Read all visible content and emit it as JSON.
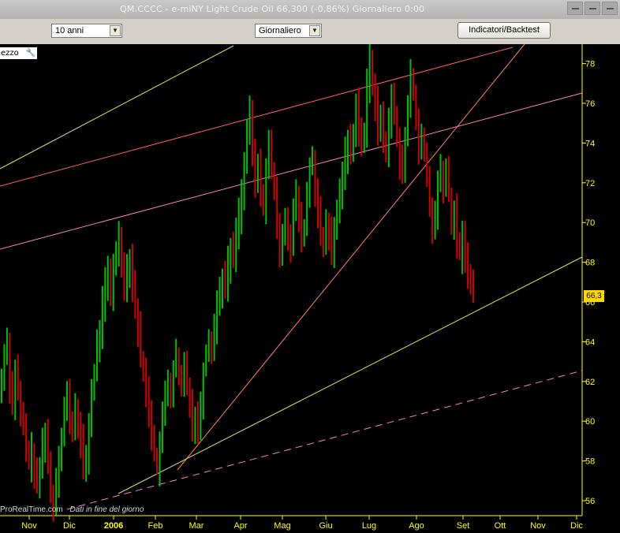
{
  "window": {
    "title": "QM.CCCC - e-miNY Light Crude Oil    66,300 (-0,86%)    Giornaliero  0:00"
  },
  "toolbar": {
    "period": "10 anni",
    "interval": "Giornaliero",
    "indicators_label": "Indicatori/Backtest"
  },
  "chart_panel": {
    "label": "ezzo",
    "price_badge": "66,3",
    "footer_source": "ProRealTime.com",
    "footer_note": "Dati in fine del giorno"
  },
  "colors": {
    "background": "#000000",
    "up": "#00c000",
    "down": "#d00000",
    "axis_text": "#ffff00",
    "badge": "#ffd700"
  },
  "chart_data": {
    "type": "bar",
    "description_free": true,
    "y_axis": {
      "min": 55.5,
      "max": 78.8,
      "ticks": [
        56,
        58,
        60,
        62,
        64,
        66,
        68,
        70,
        72,
        74,
        76,
        78
      ]
    },
    "x_ticks": [
      "Nov",
      "Dic",
      "2006",
      "Feb",
      "Mar",
      "Apr",
      "Mag",
      "Giu",
      "Lug",
      "Ago",
      "Set",
      "Ott",
      "Nov",
      "Dic"
    ],
    "last_price": 66.3,
    "closes": [
      62.0,
      63.5,
      64.1,
      61.8,
      60.9,
      62.6,
      61.4,
      60.2,
      59.7,
      58.6,
      57.9,
      58.5,
      57.2,
      56.8,
      57.6,
      58.9,
      59.5,
      57.8,
      56.4,
      55.8,
      57.1,
      58.4,
      59.2,
      60.6,
      61.3,
      60.1,
      59.4,
      60.8,
      59.7,
      58.9,
      57.6,
      58.2,
      59.8,
      61.5,
      62.4,
      63.8,
      64.6,
      65.9,
      66.8,
      67.5,
      66.1,
      67.9,
      68.6,
      69.3,
      68.2,
      66.6,
      67.7,
      68.3,
      66.9,
      65.8,
      64.6,
      63.2,
      62.4,
      61.5,
      60.6,
      59.4,
      58.3,
      57.6,
      58.8,
      60.1,
      61.4,
      62.1,
      61.2,
      62.6,
      63.3,
      62.1,
      61.6,
      62.9,
      61.9,
      61.0,
      59.8,
      60.2,
      59.6,
      61.0,
      62.6,
      63.5,
      64.2,
      63.6,
      64.8,
      65.9,
      66.6,
      67.3,
      66.8,
      67.9,
      68.6,
      68.3,
      69.6,
      70.4,
      71.5,
      72.8,
      74.6,
      75.4,
      73.4,
      72.1,
      72.8,
      71.6,
      70.9,
      72.6,
      73.9,
      72.6,
      71.8,
      69.5,
      68.4,
      69.6,
      70.3,
      69.4,
      68.9,
      70.5,
      71.3,
      70.1,
      69.2,
      69.8,
      71.4,
      72.7,
      73.3,
      71.6,
      70.4,
      69.2,
      68.7,
      70.1,
      69.4,
      68.2,
      69.6,
      70.6,
      71.4,
      72.6,
      73.4,
      74.1,
      73.5,
      74.6,
      76.1,
      74.8,
      73.9,
      74.5,
      76.8,
      78.2,
      77.1,
      75.9,
      74.6,
      75.4,
      74.2,
      73.6,
      74.9,
      76.3,
      75.5,
      74.2,
      73.1,
      72.9,
      74.2,
      75.8,
      77.3,
      76.6,
      75.2,
      73.9,
      74.1,
      73.4,
      72.2,
      70.8,
      69.6,
      70.4,
      71.9,
      72.8,
      71.6,
      72.6,
      71.4,
      69.9,
      70.5,
      69.1,
      68.4,
      69.2,
      68.3,
      67.6,
      66.9,
      66.3
    ]
  }
}
